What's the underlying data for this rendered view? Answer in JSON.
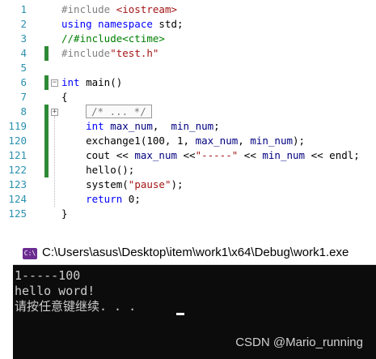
{
  "editor": {
    "lines": [
      {
        "num": "1",
        "tokens": [
          [
            "pp",
            "#include "
          ],
          [
            "str",
            "<iostream>"
          ]
        ]
      },
      {
        "num": "2",
        "tokens": [
          [
            "kw",
            "using "
          ],
          [
            "kw",
            "namespace "
          ],
          [
            "plain",
            "std;"
          ]
        ]
      },
      {
        "num": "3",
        "tokens": [
          [
            "cm",
            "//#include<ctime>"
          ]
        ]
      },
      {
        "num": "4",
        "tokens": [
          [
            "pp",
            "#include"
          ],
          [
            "str",
            "\"test.h\""
          ]
        ]
      },
      {
        "num": "5",
        "tokens": []
      },
      {
        "num": "6",
        "tokens": [
          [
            "kw",
            "int "
          ],
          [
            "plain",
            "main()"
          ]
        ]
      },
      {
        "num": "7",
        "tokens": [
          [
            "plain",
            "{"
          ]
        ]
      },
      {
        "num": "8",
        "tokens": [
          [
            "collapsed",
            "/* ... */"
          ]
        ]
      },
      {
        "num": "119",
        "tokens": [
          [
            "kw",
            "    int "
          ],
          [
            "id",
            "max_num"
          ],
          [
            "plain",
            ",  "
          ],
          [
            "id",
            "min_num"
          ],
          [
            "plain",
            ";"
          ]
        ]
      },
      {
        "num": "120",
        "tokens": [
          [
            "plain",
            "    exchange1(100, 1, "
          ],
          [
            "id",
            "max_num"
          ],
          [
            "plain",
            ", "
          ],
          [
            "id",
            "min_num"
          ],
          [
            "plain",
            ");"
          ]
        ]
      },
      {
        "num": "121",
        "tokens": [
          [
            "plain",
            "    cout << "
          ],
          [
            "id",
            "max_num"
          ],
          [
            "plain",
            " <<"
          ],
          [
            "str",
            "\"-----\""
          ],
          [
            "plain",
            " << "
          ],
          [
            "id",
            "min_num"
          ],
          [
            "plain",
            " << endl;"
          ]
        ]
      },
      {
        "num": "122",
        "tokens": [
          [
            "plain",
            "    hello();"
          ]
        ]
      },
      {
        "num": "123",
        "tokens": [
          [
            "plain",
            "    system("
          ],
          [
            "str",
            "\"pause\""
          ],
          [
            "plain",
            ");"
          ]
        ]
      },
      {
        "num": "124",
        "tokens": [
          [
            "kw",
            "    return "
          ],
          [
            "plain",
            "0;"
          ]
        ]
      },
      {
        "num": "125",
        "tokens": [
          [
            "plain",
            "}"
          ]
        ]
      }
    ]
  },
  "console": {
    "icon_label": "C:\\",
    "title": "C:\\Users\\asus\\Desktop\\item\\work1\\x64\\Debug\\work1.exe",
    "output": [
      "1-----100",
      "hello word!",
      "请按任意键继续. . . "
    ]
  },
  "watermark": "CSDN @Mario_running",
  "colors": {
    "keyword": "#0000ff",
    "string": "#a31515",
    "comment": "#008000",
    "preprocessor": "#808080",
    "line_number": "#2b91af",
    "change_bar": "#2e8b35",
    "console_bg": "#0c0c0c",
    "console_fg": "#cccccc"
  },
  "icons": {
    "console_icon": "cmd-window-icon",
    "fold_minus": "collapse-icon",
    "fold_plus": "expand-icon"
  }
}
